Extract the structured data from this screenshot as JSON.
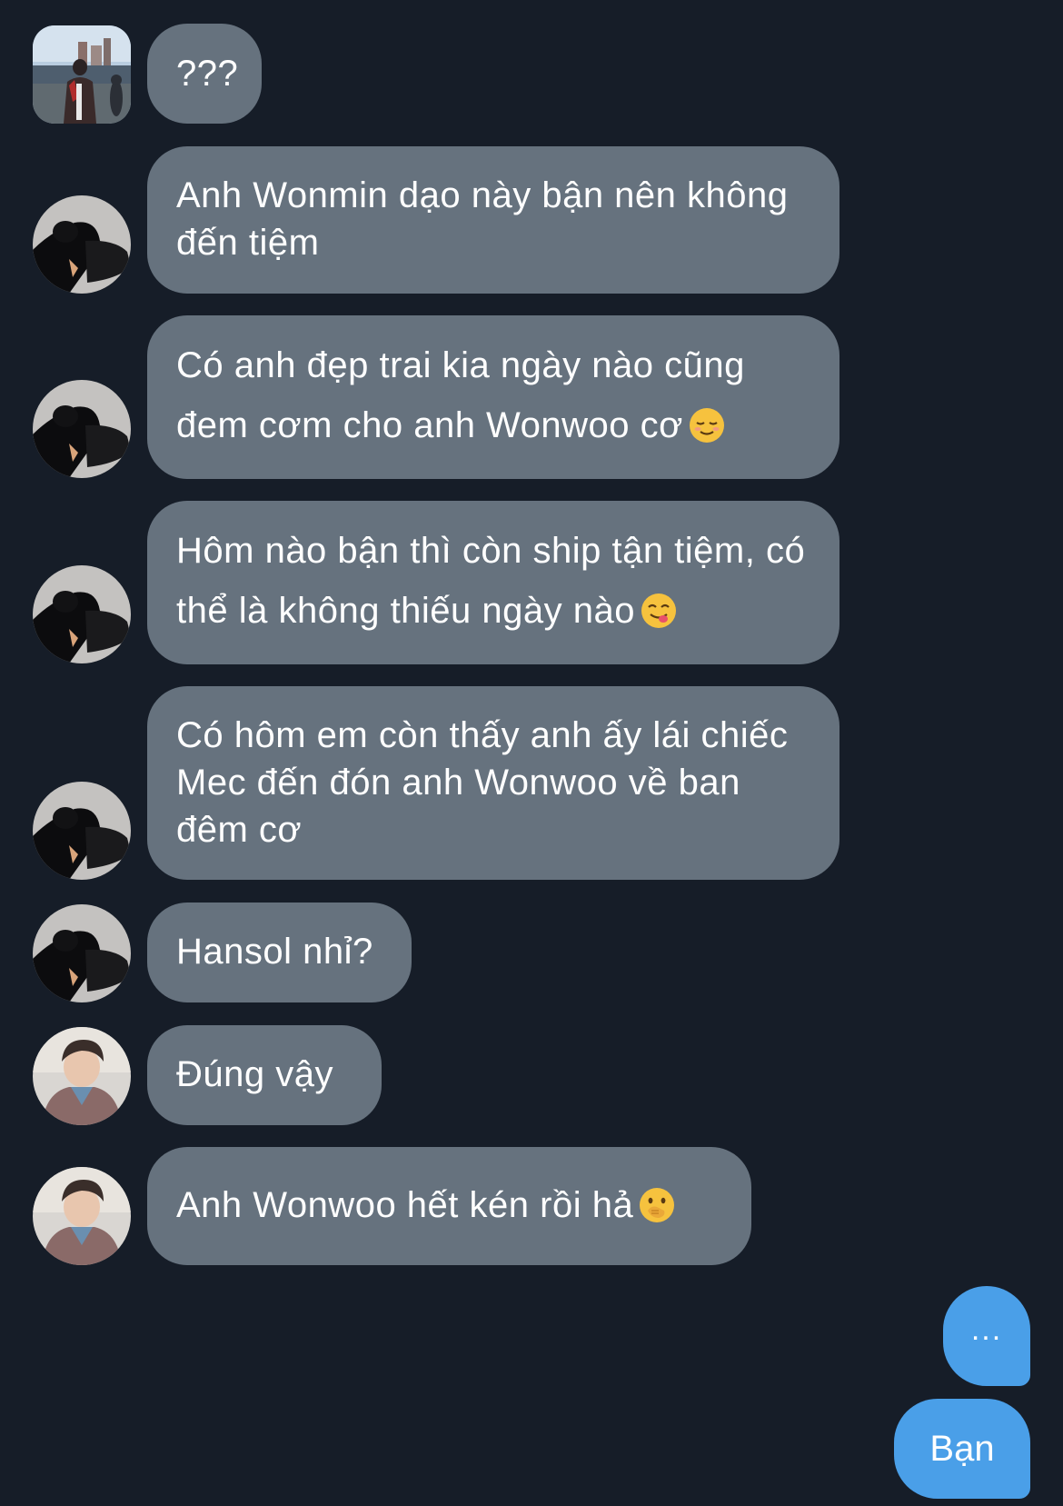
{
  "conversation": {
    "messages": [
      {
        "sender": "other",
        "text": "???",
        "avatar_icon": "photo-avatar-man-city"
      },
      {
        "sender": "other",
        "text": "Anh Wonmin dạo này bận nên không đến tiệm",
        "avatar_icon": "photo-avatar-dark-figure"
      },
      {
        "sender": "other",
        "text": "Có anh đẹp trai kia ngày nào cũng đem cơm cho anh Wonwoo cơ",
        "emoji": "relieved-face-emoji",
        "avatar_icon": "photo-avatar-dark-figure"
      },
      {
        "sender": "other",
        "text": "Hôm nào bận thì còn ship tận tiệm, có thể là không thiếu ngày nào",
        "emoji": "yum-face-emoji",
        "avatar_icon": "photo-avatar-dark-figure"
      },
      {
        "sender": "other",
        "text": "Có hôm em còn thấy anh ấy lái chiếc Mec đến đón anh Wonwoo về ban đêm cơ",
        "avatar_icon": "photo-avatar-dark-figure"
      },
      {
        "sender": "other",
        "text": "Hansol nhỉ?",
        "avatar_icon": "photo-avatar-dark-figure"
      },
      {
        "sender": "other",
        "text": "Đúng vậy",
        "avatar_icon": "photo-avatar-man-jacket"
      },
      {
        "sender": "other",
        "text": "Anh Wonwoo hết kén rồi hả",
        "emoji": "hand-over-mouth-emoji",
        "avatar_icon": "photo-avatar-man-jacket"
      },
      {
        "sender": "me",
        "text": "..."
      },
      {
        "sender": "me",
        "text": "Bạn"
      }
    ]
  },
  "colors": {
    "background": "#161d28",
    "incoming_bubble": "#66727e",
    "outgoing_bubble": "#4a9fe8",
    "text": "#ffffff"
  }
}
